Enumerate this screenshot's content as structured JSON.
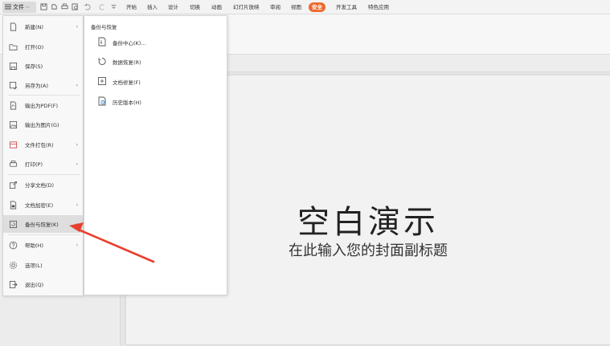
{
  "topbar": {
    "file_label": "文件",
    "tabs": [
      "开始",
      "插入",
      "设计",
      "切换",
      "动画",
      "幻灯片放映",
      "审阅",
      "视图",
      "安全",
      "开发工具",
      "特色应用"
    ]
  },
  "file_menu": {
    "items": [
      {
        "label": "新建(N)",
        "icon": "new-file-icon"
      },
      {
        "label": "打开(O)",
        "icon": "folder-icon"
      },
      {
        "label": "保存(S)",
        "icon": "save-icon"
      },
      {
        "label": "另存为(A)",
        "icon": "save-as-icon"
      },
      {
        "label": "输出为PDF(F)",
        "icon": "pdf-icon"
      },
      {
        "label": "输出为图片(G)",
        "icon": "image-icon"
      },
      {
        "label": "文件打包(R)",
        "icon": "package-icon"
      },
      {
        "label": "打印(P)",
        "icon": "printer-icon"
      },
      {
        "label": "分享文档(D)",
        "icon": "share-icon"
      },
      {
        "label": "文档加密(E)",
        "icon": "lock-icon"
      },
      {
        "label": "备份与恢复(K)",
        "icon": "backup-icon"
      },
      {
        "label": "帮助(H)",
        "icon": "help-icon"
      },
      {
        "label": "选项(L)",
        "icon": "gear-icon"
      },
      {
        "label": "退出(Q)",
        "icon": "exit-icon"
      }
    ]
  },
  "submenu": {
    "heading": "备份与恢复",
    "items": [
      {
        "label": "备份中心(K)...",
        "icon": "backup-center-icon"
      },
      {
        "label": "数据恢复(R)",
        "icon": "data-recovery-icon"
      },
      {
        "label": "文档修复(F)",
        "icon": "doc-repair-icon"
      },
      {
        "label": "历史版本(H)",
        "icon": "history-icon"
      }
    ]
  },
  "slide": {
    "title": "空白演示",
    "subtitle": "在此输入您的封面副标题"
  },
  "colors": {
    "accent": "#ec6a2f",
    "annotation": "#e8402f"
  }
}
